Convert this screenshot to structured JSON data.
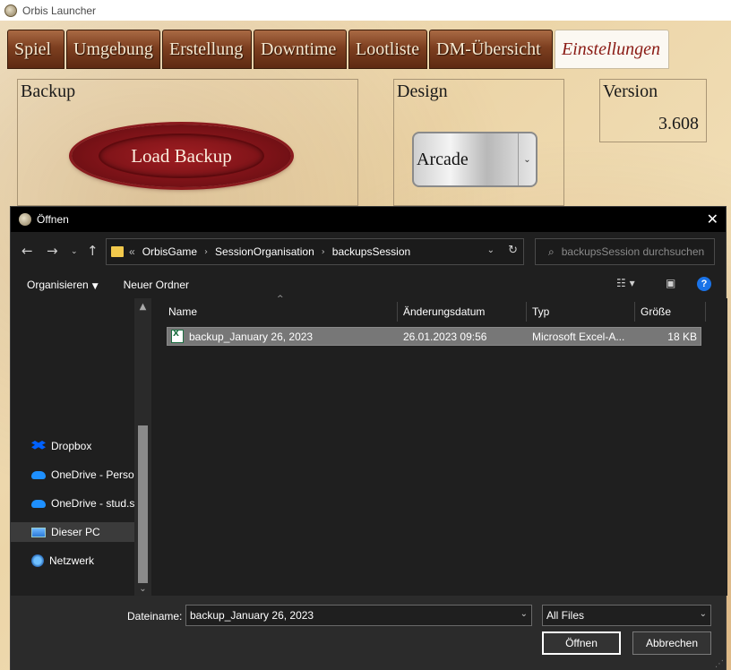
{
  "window": {
    "title": "Orbis Launcher"
  },
  "tabs": [
    {
      "label": "Spiel"
    },
    {
      "label": "Umgebung"
    },
    {
      "label": "Erstellung"
    },
    {
      "label": "Downtime"
    },
    {
      "label": "Lootliste"
    },
    {
      "label": "DM-Übersicht"
    },
    {
      "label": "Einstellungen",
      "active": true
    }
  ],
  "backup": {
    "title": "Backup",
    "button_label": "Load Backup"
  },
  "design": {
    "title": "Design",
    "selected": "Arcade"
  },
  "version": {
    "title": "Version",
    "value": "3.608"
  },
  "dialog": {
    "title": "Öffnen",
    "path": [
      "OrbisGame",
      "SessionOrganisation",
      "backupsSession"
    ],
    "path_prefix": "«",
    "search_placeholder": "backupsSession durchsuchen",
    "organize_label": "Organisieren",
    "new_folder_label": "Neuer Ordner",
    "columns": [
      "Name",
      "Änderungsdatum",
      "Typ",
      "Größe"
    ],
    "files": [
      {
        "name": "backup_January 26, 2023",
        "date": "26.01.2023 09:56",
        "type": "Microsoft Excel-A...",
        "size": "18 KB"
      }
    ],
    "nav_items": [
      {
        "label": "Dropbox",
        "icon": "dropbox-icon"
      },
      {
        "label": "OneDrive - Persona",
        "icon": "onedrive-icon"
      },
      {
        "label": "OneDrive - stud.sb",
        "icon": "onedrive-icon"
      },
      {
        "label": "Dieser PC",
        "icon": "pc-icon",
        "selected": true
      },
      {
        "label": "Netzwerk",
        "icon": "network-icon"
      }
    ],
    "filename_label": "Dateiname:",
    "filename_value": "backup_January 26, 2023",
    "filetype": "All Files",
    "open_label": "Öffnen",
    "cancel_label": "Abbrechen"
  }
}
